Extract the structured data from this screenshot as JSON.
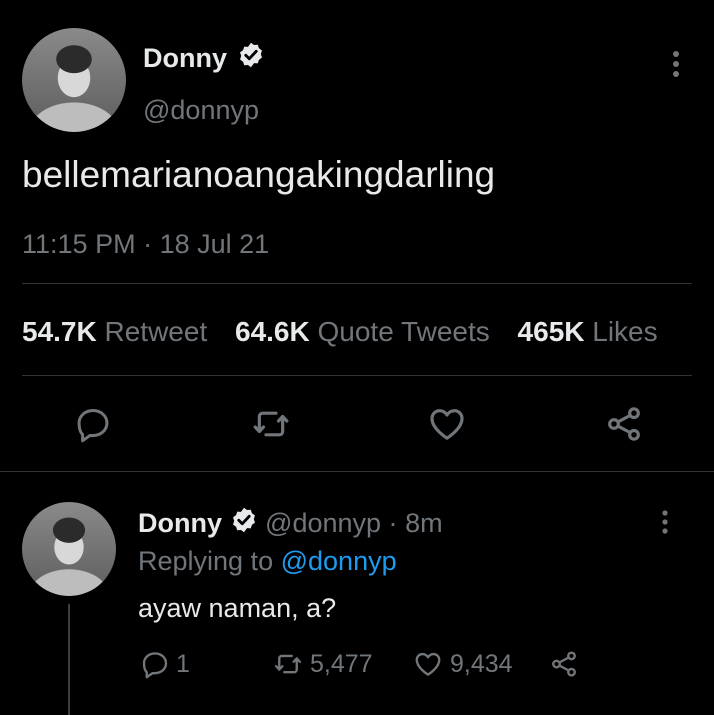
{
  "tweet": {
    "author_name": "Donny",
    "author_handle": "@donnyp",
    "text": "bellemarianoangakingdarling",
    "time": "11:15 PM",
    "separator": "·",
    "date": "18 Jul 21",
    "stats": {
      "retweets_count": "54.7K",
      "retweets_label": "Retweet",
      "quotes_count": "64.6K",
      "quotes_label": "Quote Tweets",
      "likes_count": "465K",
      "likes_label": "Likes"
    },
    "icons": [
      "reply-icon",
      "retweet-icon",
      "like-icon",
      "share-icon"
    ]
  },
  "reply": {
    "author_name": "Donny",
    "author_handle": "@donnyp",
    "separator": "·",
    "age": "8m",
    "replying_to_label": "Replying to",
    "replying_to_handle": "@donnyp",
    "text": "ayaw naman, a?",
    "reply_count": "1",
    "retweet_count": "5,477",
    "like_count": "9,434"
  },
  "colors": {
    "background": "#000000",
    "text": "#e7e9ea",
    "muted": "#71767b",
    "link": "#1d9bf0",
    "divider": "#2f3336"
  }
}
